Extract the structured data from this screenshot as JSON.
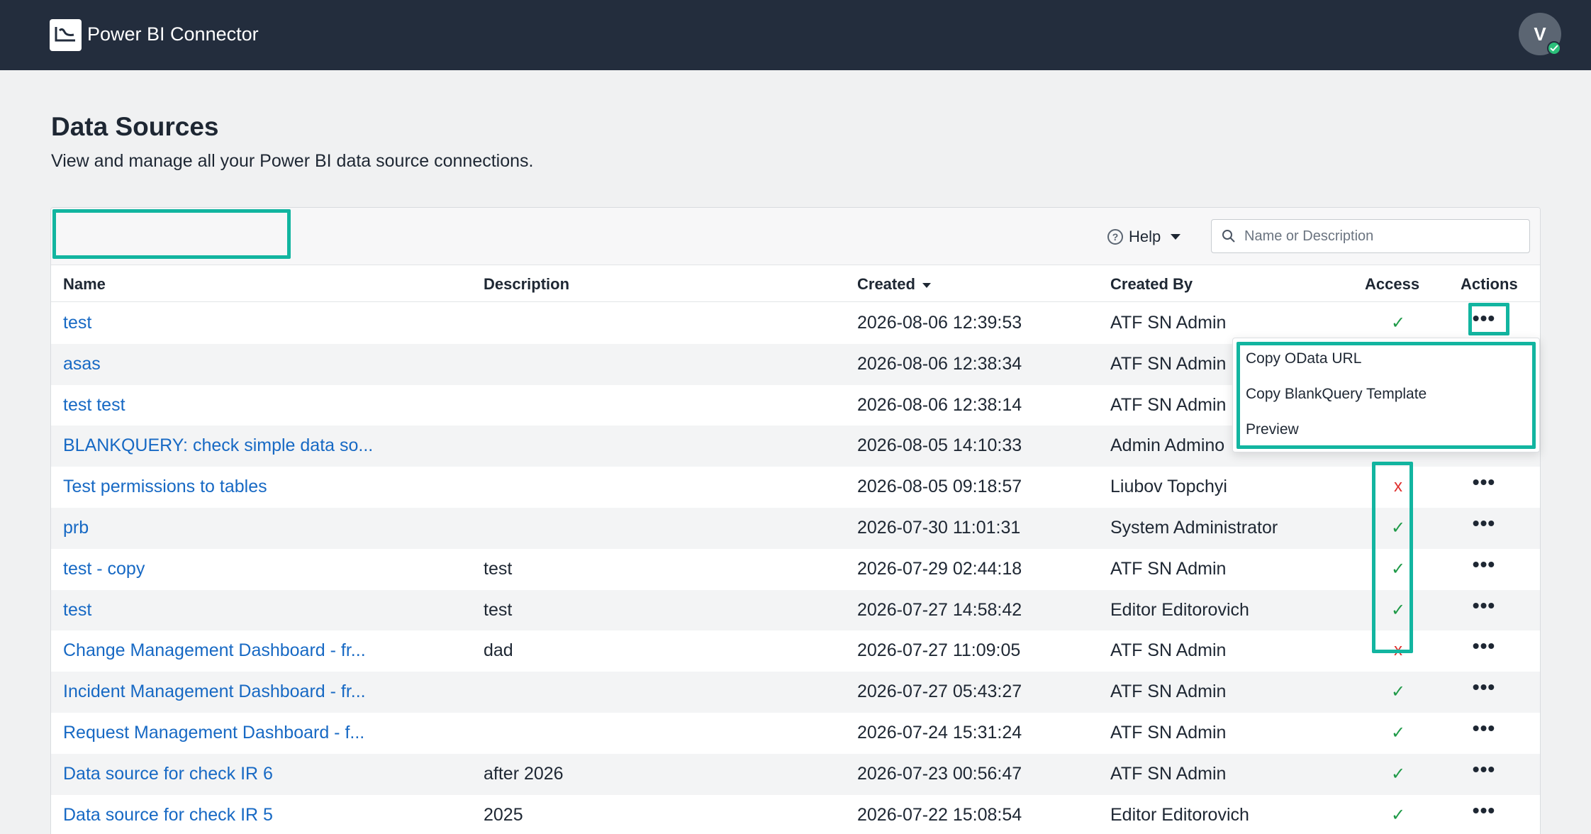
{
  "app": {
    "title": "Power BI Connector",
    "avatar_initial": "V"
  },
  "page": {
    "title": "Data Sources",
    "subtitle": "View and manage all your Power BI data source connections."
  },
  "toolbar": {
    "help_label": "Help",
    "search_placeholder": "Name or Description",
    "search_value": ""
  },
  "table": {
    "columns": {
      "name": "Name",
      "description": "Description",
      "created": "Created",
      "created_by": "Created By",
      "access": "Access",
      "actions": "Actions"
    },
    "rows": [
      {
        "name": "test",
        "description": "",
        "created": "2026-08-06 12:39:53",
        "created_by": "ATF SN Admin",
        "access": "✓"
      },
      {
        "name": "asas",
        "description": "",
        "created": "2026-08-06 12:38:34",
        "created_by": "ATF SN Admin",
        "access": ""
      },
      {
        "name": "test test",
        "description": "",
        "created": "2026-08-06 12:38:14",
        "created_by": "ATF SN Admin",
        "access": ""
      },
      {
        "name": "BLANKQUERY: check simple data so...",
        "description": "",
        "created": "2026-08-05 14:10:33",
        "created_by": "Admin Admino",
        "access": ""
      },
      {
        "name": "Test permissions to tables",
        "description": "",
        "created": "2026-08-05 09:18:57",
        "created_by": "Liubov Topchyi",
        "access": "x"
      },
      {
        "name": "prb",
        "description": "",
        "created": "2026-07-30 11:01:31",
        "created_by": "System Administrator",
        "access": "✓"
      },
      {
        "name": "test - copy",
        "description": "test",
        "created": "2026-07-29 02:44:18",
        "created_by": "ATF SN Admin",
        "access": "✓"
      },
      {
        "name": "test",
        "description": "test",
        "created": "2026-07-27 14:58:42",
        "created_by": "Editor Editorovich",
        "access": "✓"
      },
      {
        "name": "Change Management Dashboard - fr...",
        "description": "dad",
        "created": "2026-07-27 11:09:05",
        "created_by": "ATF SN Admin",
        "access": "x"
      },
      {
        "name": "Incident Management Dashboard - fr...",
        "description": "",
        "created": "2026-07-27 05:43:27",
        "created_by": "ATF SN Admin",
        "access": "✓"
      },
      {
        "name": "Request Management Dashboard - f...",
        "description": "",
        "created": "2026-07-24 15:31:24",
        "created_by": "ATF SN Admin",
        "access": "✓"
      },
      {
        "name": "Data source for check IR 6",
        "description": "after 2026",
        "created": "2026-07-23 00:56:47",
        "created_by": "ATF SN Admin",
        "access": "✓"
      },
      {
        "name": "Data source for check IR 5",
        "description": "2025",
        "created": "2026-07-22 15:08:54",
        "created_by": "Editor Editorovich",
        "access": "✓"
      }
    ],
    "actions_glyph": "•••"
  },
  "actions_menu": {
    "items": [
      "Copy OData URL",
      "Copy BlankQuery Template",
      "Preview"
    ]
  },
  "colors": {
    "header_bg": "#232d3d",
    "link": "#1769c4",
    "access_yes": "#1f9a48",
    "access_no": "#e0312f",
    "highlight": "#12b5a0"
  }
}
